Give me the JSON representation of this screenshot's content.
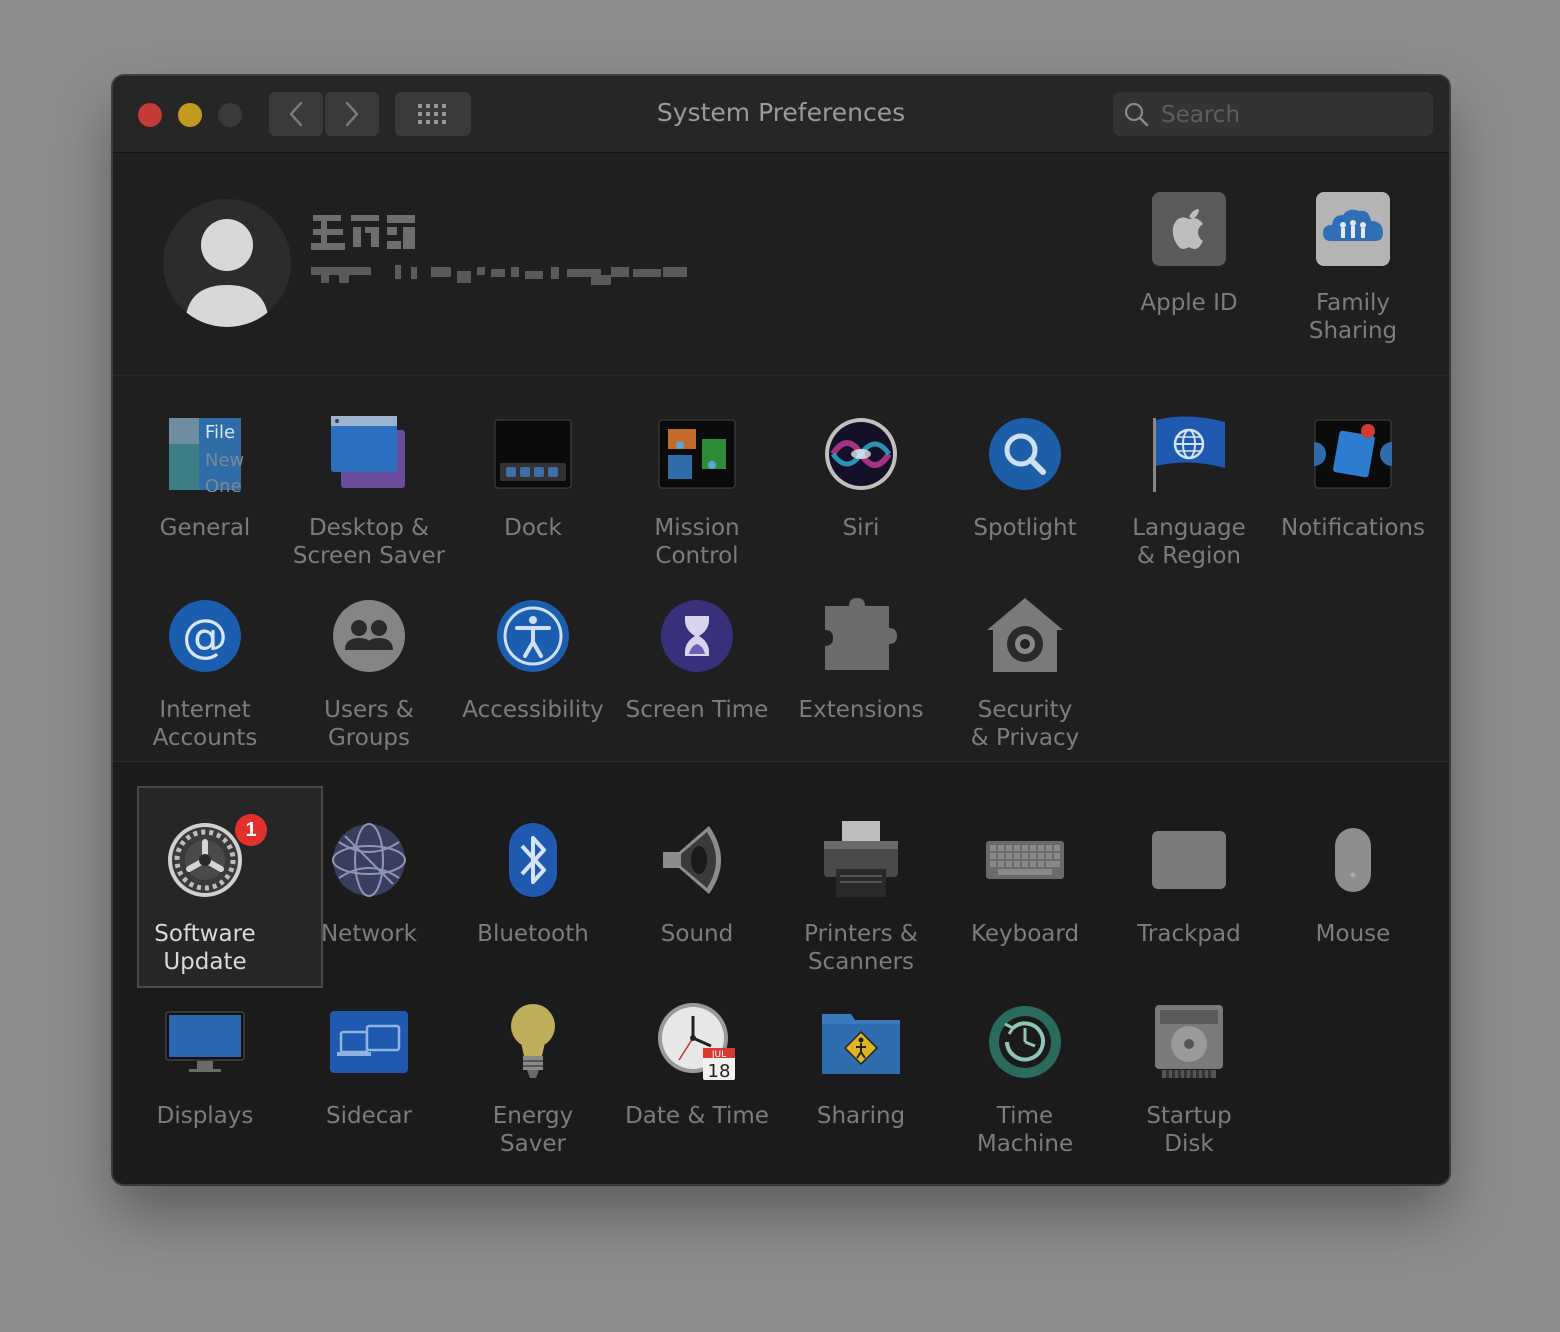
{
  "window": {
    "title": "System Preferences",
    "search_placeholder": "Search"
  },
  "account": {
    "actions": [
      {
        "label": "Apple ID",
        "icon": "apple-id-icon"
      },
      {
        "label": "Family\nSharing",
        "icon": "family-sharing-icon"
      }
    ]
  },
  "prefs_personal": [
    {
      "label": "General",
      "icon": "general-icon"
    },
    {
      "label": "Desktop &\nScreen Saver",
      "icon": "desktop-screensaver-icon"
    },
    {
      "label": "Dock",
      "icon": "dock-icon"
    },
    {
      "label": "Mission\nControl",
      "icon": "mission-control-icon"
    },
    {
      "label": "Siri",
      "icon": "siri-icon"
    },
    {
      "label": "Spotlight",
      "icon": "spotlight-icon"
    },
    {
      "label": "Language\n& Region",
      "icon": "language-region-icon"
    },
    {
      "label": "Notifications",
      "icon": "notifications-icon"
    },
    {
      "label": "Internet\nAccounts",
      "icon": "internet-accounts-icon"
    },
    {
      "label": "Users &\nGroups",
      "icon": "users-groups-icon"
    },
    {
      "label": "Accessibility",
      "icon": "accessibility-icon"
    },
    {
      "label": "Screen Time",
      "icon": "screen-time-icon"
    },
    {
      "label": "Extensions",
      "icon": "extensions-icon"
    },
    {
      "label": "Security\n& Privacy",
      "icon": "security-privacy-icon"
    }
  ],
  "prefs_hardware": [
    {
      "label": "Software\nUpdate",
      "icon": "software-update-icon",
      "badge": "1",
      "selected": true
    },
    {
      "label": "Network",
      "icon": "network-icon"
    },
    {
      "label": "Bluetooth",
      "icon": "bluetooth-icon"
    },
    {
      "label": "Sound",
      "icon": "sound-icon"
    },
    {
      "label": "Printers &\nScanners",
      "icon": "printers-scanners-icon"
    },
    {
      "label": "Keyboard",
      "icon": "keyboard-icon"
    },
    {
      "label": "Trackpad",
      "icon": "trackpad-icon"
    },
    {
      "label": "Mouse",
      "icon": "mouse-icon"
    },
    {
      "label": "Displays",
      "icon": "displays-icon"
    },
    {
      "label": "Sidecar",
      "icon": "sidecar-icon"
    },
    {
      "label": "Energy\nSaver",
      "icon": "energy-saver-icon"
    },
    {
      "label": "Date & Time",
      "icon": "date-time-icon",
      "calendar_month": "JUL",
      "calendar_day": "18"
    },
    {
      "label": "Sharing",
      "icon": "sharing-icon"
    },
    {
      "label": "Time\nMachine",
      "icon": "time-machine-icon"
    },
    {
      "label": "Startup\nDisk",
      "icon": "startup-disk-icon"
    }
  ],
  "general_icon_text": [
    "File",
    "New",
    "One"
  ],
  "colors": {
    "accent_red": "#e3302c",
    "label_dim": "#7c7c7c",
    "label_selected": "#d8d8d8"
  }
}
